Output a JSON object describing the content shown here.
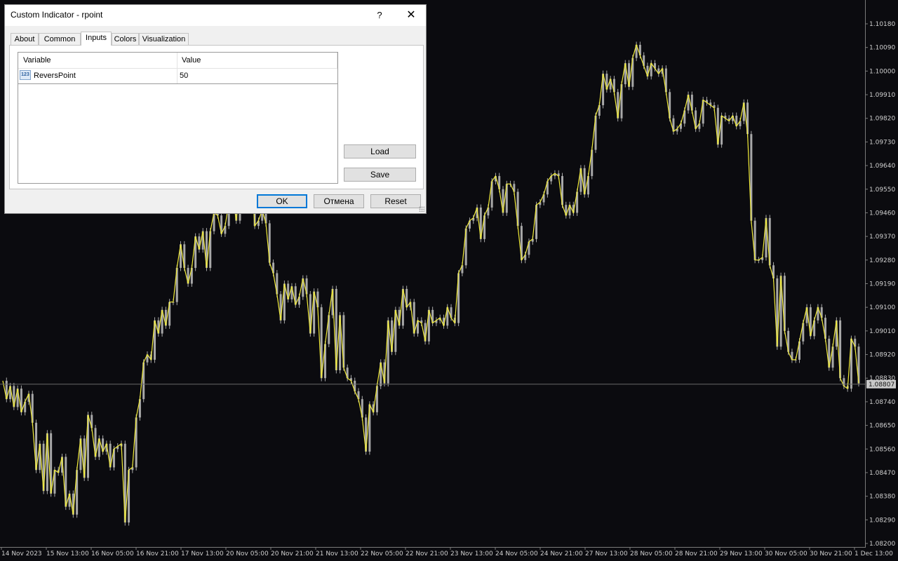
{
  "dialog": {
    "title": "Custom Indicator - rpoint",
    "help_label": "?",
    "close_label": "✕",
    "tabs": [
      {
        "label": "About"
      },
      {
        "label": "Common"
      },
      {
        "label": "Inputs"
      },
      {
        "label": "Colors"
      },
      {
        "label": "Visualization"
      }
    ],
    "active_tab": "Inputs",
    "table": {
      "headers": {
        "variable": "Variable",
        "value": "Value"
      },
      "rows": [
        {
          "icon": "integer-param-icon",
          "icon_text": "123",
          "variable": "ReversPoint",
          "value": "50"
        }
      ]
    },
    "buttons": {
      "load": "Load",
      "save": "Save",
      "ok": "OK",
      "cancel": "Отмена",
      "reset": "Reset"
    }
  },
  "chart_data": {
    "type": "candlestick",
    "colors": {
      "background": "#0b0b0f",
      "candles": "#a8a8a8",
      "zigzag": "#f2ec3a",
      "current_price_line": "#6a6a6a"
    },
    "y_axis": {
      "range": [
        1.082,
        1.1018
      ],
      "ticks": [
        "1.10180",
        "1.10090",
        "1.10000",
        "1.09910",
        "1.09820",
        "1.09730",
        "1.09640",
        "1.09550",
        "1.09460",
        "1.09370",
        "1.09280",
        "1.09190",
        "1.09100",
        "1.09010",
        "1.08920",
        "1.08830",
        "1.08740",
        "1.08650",
        "1.08560",
        "1.08470",
        "1.08380",
        "1.08290",
        "1.08200"
      ]
    },
    "current_price": "1.08807",
    "x_axis": {
      "ticks": [
        "14 Nov 2023",
        "15 Nov 13:00",
        "16 Nov 05:00",
        "16 Nov 21:00",
        "17 Nov 13:00",
        "20 Nov 05:00",
        "20 Nov 21:00",
        "21 Nov 13:00",
        "22 Nov 05:00",
        "22 Nov 21:00",
        "23 Nov 13:00",
        "24 Nov 05:00",
        "24 Nov 21:00",
        "27 Nov 13:00",
        "28 Nov 05:00",
        "28 Nov 21:00",
        "29 Nov 13:00",
        "30 Nov 05:00",
        "30 Nov 21:00",
        "1 Dec 13:00"
      ]
    },
    "path_prices": [
      1.0882,
      1.0875,
      1.088,
      1.0872,
      1.0879,
      1.087,
      1.0874,
      1.0877,
      1.0866,
      1.0848,
      1.0858,
      1.084,
      1.0862,
      1.0839,
      1.0848,
      1.0847,
      1.0853,
      1.0834,
      1.0839,
      1.0831,
      1.0848,
      1.086,
      1.0845,
      1.0869,
      1.0864,
      1.0853,
      1.086,
      1.0855,
      1.0858,
      1.0849,
      1.0856,
      1.0857,
      1.0858,
      1.0828,
      1.0848,
      1.0849,
      1.0868,
      1.0875,
      1.0889,
      1.0892,
      1.089,
      1.0905,
      1.09,
      1.0909,
      1.0903,
      1.0912,
      1.0912,
      1.0925,
      1.0934,
      1.0925,
      1.0919,
      1.0925,
      1.0937,
      1.0932,
      1.0939,
      1.0925,
      1.0939,
      1.0946,
      1.0945,
      1.0938,
      1.0941,
      1.095,
      1.0953,
      1.0943,
      1.0956,
      1.0956,
      1.096,
      1.0964,
      1.0941,
      1.0943,
      1.0947,
      1.0942,
      1.0927,
      1.0923,
      1.0915,
      1.0905,
      1.0919,
      1.0913,
      1.0918,
      1.0911,
      1.0914,
      1.0921,
      1.0915,
      1.09,
      1.0916,
      1.091,
      1.0883,
      1.0896,
      1.0907,
      1.0917,
      1.0886,
      1.0907,
      1.0887,
      1.0883,
      1.0882,
      1.0878,
      1.0875,
      1.0868,
      1.0855,
      1.0873,
      1.087,
      1.088,
      1.0889,
      1.0881,
      1.0905,
      1.0893,
      1.0909,
      1.0903,
      1.0917,
      1.091,
      1.0912,
      1.09,
      1.0905,
      1.0904,
      1.0897,
      1.0909,
      1.0904,
      1.0905,
      1.0906,
      1.0903,
      1.091,
      1.0906,
      1.0904,
      1.0923,
      1.0926,
      1.094,
      1.0943,
      1.0944,
      1.0948,
      1.0936,
      1.0945,
      1.0948,
      1.0958,
      1.096,
      1.0955,
      1.0946,
      1.0957,
      1.0957,
      1.0954,
      1.0941,
      1.0928,
      1.093,
      1.0935,
      1.0936,
      1.0949,
      1.095,
      1.0953,
      1.0958,
      1.096,
      1.0961,
      1.096,
      1.0949,
      1.0945,
      1.0949,
      1.0946,
      1.0954,
      1.0963,
      1.0953,
      1.096,
      1.097,
      1.0983,
      1.0987,
      1.0999,
      1.0993,
      1.0997,
      1.0992,
      1.0982,
      1.0995,
      1.1003,
      1.0994,
      1.1005,
      1.101,
      1.1006,
      1.1002,
      1.0998,
      1.1003,
      1.1001,
      1.0999,
      1.1001,
      1.0992,
      1.0982,
      1.0977,
      1.0978,
      1.098,
      1.0985,
      1.0991,
      1.0985,
      1.0978,
      1.098,
      1.0989,
      1.0988,
      1.0987,
      1.0986,
      1.0972,
      1.0983,
      1.0982,
      1.0981,
      1.0983,
      1.0979,
      1.0981,
      1.0988,
      1.0976,
      1.0943,
      1.0928,
      1.0928,
      1.0929,
      1.0944,
      1.0926,
      1.0921,
      1.0895,
      1.0922,
      1.0901,
      1.0893,
      1.089,
      1.089,
      1.0897,
      1.0904,
      1.091,
      1.0899,
      1.0905,
      1.091,
      1.0906,
      1.0898,
      1.0887,
      1.0895,
      1.0905,
      1.0883,
      1.088,
      1.0879,
      1.0898,
      1.0895,
      1.0881
    ]
  }
}
